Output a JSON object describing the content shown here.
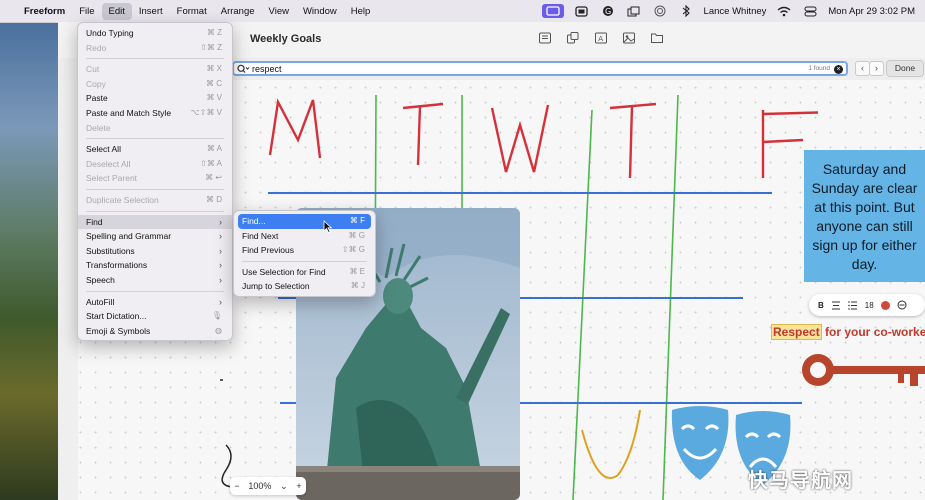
{
  "menubar": {
    "app_name": "Freeform",
    "items": [
      "File",
      "Edit",
      "Insert",
      "Format",
      "Arrange",
      "View",
      "Window",
      "Help"
    ],
    "user": "Lance Whitney",
    "datetime": "Mon Apr 29  3:02 PM"
  },
  "window": {
    "title": "Weekly Goals",
    "find": {
      "query": "respect",
      "count": "1 found",
      "done_label": "Done"
    }
  },
  "edit_menu": {
    "undo": {
      "label": "Undo Typing",
      "shortcut": "⌘ Z"
    },
    "redo": {
      "label": "Redo",
      "shortcut": "⇧⌘ Z"
    },
    "cut": {
      "label": "Cut",
      "shortcut": "⌘ X"
    },
    "copy": {
      "label": "Copy",
      "shortcut": "⌘ C"
    },
    "paste": {
      "label": "Paste",
      "shortcut": "⌘ V"
    },
    "paste_match": {
      "label": "Paste and Match Style",
      "shortcut": "⌥⇧⌘ V"
    },
    "delete": {
      "label": "Delete"
    },
    "select_all": {
      "label": "Select All",
      "shortcut": "⌘ A"
    },
    "deselect_all": {
      "label": "Deselect All",
      "shortcut": "⇧⌘ A"
    },
    "select_parent": {
      "label": "Select Parent",
      "shortcut": "⌘ ↩"
    },
    "duplicate": {
      "label": "Duplicate Selection",
      "shortcut": "⌘ D"
    },
    "find": {
      "label": "Find"
    },
    "spelling": {
      "label": "Spelling and Grammar"
    },
    "substitutions": {
      "label": "Substitutions"
    },
    "transformations": {
      "label": "Transformations"
    },
    "speech": {
      "label": "Speech"
    },
    "autofill": {
      "label": "AutoFill"
    },
    "dictation": {
      "label": "Start Dictation..."
    },
    "emoji": {
      "label": "Emoji & Symbols"
    }
  },
  "find_submenu": {
    "find": {
      "label": "Find...",
      "shortcut": "⌘ F"
    },
    "find_next": {
      "label": "Find Next",
      "shortcut": "⌘ G"
    },
    "find_previous": {
      "label": "Find Previous",
      "shortcut": "⇧⌘ G"
    },
    "use_selection": {
      "label": "Use Selection for Find",
      "shortcut": "⌘ E"
    },
    "jump": {
      "label": "Jump to Selection",
      "shortcut": "⌘ J"
    }
  },
  "board": {
    "days": [
      "M",
      "T",
      "W",
      "T",
      "F"
    ],
    "note_text": "Saturday and Sunday are clear at this point. But anyone can still sign up for either day.",
    "text_style": {
      "bold": "B",
      "size": "18"
    },
    "respect_word": "Respect",
    "respect_rest": " for your co-worke",
    "zoom": {
      "minus": "−",
      "value": "100%",
      "caret": "⌄",
      "plus": "+"
    }
  },
  "watermark": "快马导航网",
  "colors": {
    "accent": "#3d7ef0",
    "note": "#64b4e6",
    "ink_red": "#d4313a",
    "ink_green": "#4db84d",
    "ink_blue": "#3a6fd6"
  }
}
